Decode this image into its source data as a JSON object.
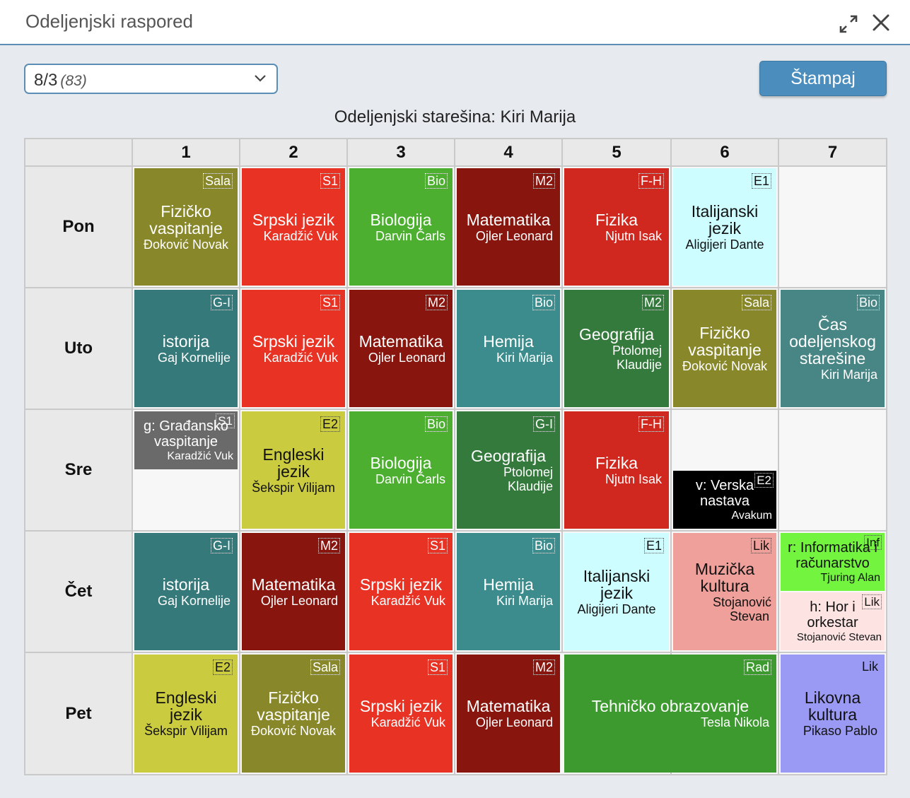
{
  "window": {
    "title": "Odeljenjski raspored"
  },
  "toolbar": {
    "class_select": {
      "value": "8/3",
      "count": "(83)"
    },
    "print_label": "Štampaj"
  },
  "head_teacher": "Odeljenjski starešina: Kiri Marija",
  "periods": [
    "1",
    "2",
    "3",
    "4",
    "5",
    "6",
    "7"
  ],
  "days": [
    "Pon",
    "Uto",
    "Sre",
    "Čet",
    "Pet"
  ],
  "colors": {
    "olive": "#88872a",
    "red": "#e73224",
    "green": "#4caf30",
    "darkred": "#88160f",
    "teal": "#36797a",
    "tealmid": "#3d8c8d",
    "forest": "#347a3c",
    "lightcyan": "#cdfdff",
    "yellowgreen": "#cbcb3f",
    "pink": "#f0a09a",
    "lavender": "#9a9af5",
    "gray": "#6a6a6a",
    "black": "#000000",
    "lime": "#73f43f",
    "lightpink": "#fde4e3",
    "kelly": "#3c9a2f"
  },
  "lessons": {
    "pon": [
      {
        "subject": "Fizičko vaspitanje",
        "teacher": "Đoković Novak",
        "room": "Sala"
      },
      {
        "subject": "Srpski jezik",
        "teacher": "Karadžić Vuk",
        "room": "S1"
      },
      {
        "subject": "Biologija",
        "teacher": "Darvin Čarls",
        "room": "Bio"
      },
      {
        "subject": "Matematika",
        "teacher": "Ojler Leonard",
        "room": "M2"
      },
      {
        "subject": "Fizika",
        "teacher": "Njutn Isak",
        "room": "F-H"
      },
      {
        "subject": "Italijanski jezik",
        "teacher": "Aligijeri Dante",
        "room": "E1"
      }
    ],
    "uto": [
      {
        "subject": "istorija",
        "teacher": "Gaj Kornelije",
        "room": "G-I"
      },
      {
        "subject": "Srpski jezik",
        "teacher": "Karadžić Vuk",
        "room": "S1"
      },
      {
        "subject": "Matematika",
        "teacher": "Ojler Leonard",
        "room": "M2"
      },
      {
        "subject": "Hemija",
        "teacher": "Kiri Marija",
        "room": "Bio"
      },
      {
        "subject": "Geografija",
        "teacher": "Ptolomej Klaudije",
        "room": "M2"
      },
      {
        "subject": "Fizičko vaspitanje",
        "teacher": "Đoković Novak",
        "room": "Sala"
      },
      {
        "subject": "Čas odeljenskog starešine",
        "teacher": "Kiri Marija",
        "room": "Bio"
      }
    ],
    "sre": [
      {
        "subject": "g: Građansko vaspitanje",
        "teacher": "Karadžić Vuk",
        "room": "S1"
      },
      {
        "subject": "Engleski jezik",
        "teacher": "Šekspir Vilijam",
        "room": "E2"
      },
      {
        "subject": "Biologija",
        "teacher": "Darvin Čarls",
        "room": "Bio"
      },
      {
        "subject": "Geografija",
        "teacher": "Ptolomej Klaudije",
        "room": "G-I"
      },
      {
        "subject": "Fizika",
        "teacher": "Njutn Isak",
        "room": "F-H"
      },
      {
        "subject": "v: Verska nastava",
        "teacher": "Avakum",
        "room": "E2"
      }
    ],
    "cet": [
      {
        "subject": "istorija",
        "teacher": "Gaj Kornelije",
        "room": "G-I"
      },
      {
        "subject": "Matematika",
        "teacher": "Ojler Leonard",
        "room": "M2"
      },
      {
        "subject": "Srpski jezik",
        "teacher": "Karadžić Vuk",
        "room": "S1"
      },
      {
        "subject": "Hemija",
        "teacher": "Kiri Marija",
        "room": "Bio"
      },
      {
        "subject": "Italijanski jezik",
        "teacher": "Aligijeri Dante",
        "room": "E1"
      },
      {
        "subject": "Muzička kultura",
        "teacher": "Stojanović Stevan",
        "room": "Lik"
      },
      {
        "subject": "r: Informatika i računarstvo",
        "teacher": "Tjuring Alan",
        "room": "Inf"
      },
      {
        "subject": "h: Hor i orkestar",
        "teacher": "Stojanović Stevan",
        "room": "Lik"
      }
    ],
    "pet": [
      {
        "subject": "Engleski jezik",
        "teacher": "Šekspir Vilijam",
        "room": "E2"
      },
      {
        "subject": "Fizičko vaspitanje",
        "teacher": "Đoković Novak",
        "room": "Sala"
      },
      {
        "subject": "Srpski jezik",
        "teacher": "Karadžić Vuk",
        "room": "S1"
      },
      {
        "subject": "Matematika",
        "teacher": "Ojler Leonard",
        "room": "M2"
      },
      {
        "subject": "Tehničko obrazovanje",
        "teacher": "Tesla Nikola",
        "room": "Rad"
      },
      {
        "subject": "Likovna kultura",
        "teacher": "Pikaso Pablo",
        "room": "Lik"
      }
    ]
  }
}
